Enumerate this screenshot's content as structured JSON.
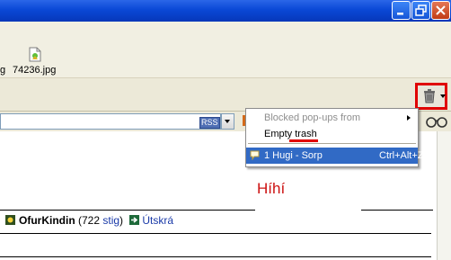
{
  "window": {
    "controls": [
      "minimize",
      "restore",
      "close"
    ]
  },
  "file_strip": {
    "items": [
      {
        "label": "g",
        "icon": "file-icon"
      },
      {
        "label": "74236.jpg",
        "icon": "image-file-icon"
      }
    ]
  },
  "toolbar": {
    "trash_button_icon": "trash-can-icon"
  },
  "address_bar": {
    "feed_badge": "RSS"
  },
  "popup_menu": {
    "items": [
      {
        "label": "Blocked pop-ups from",
        "state": "disabled",
        "submenu": true
      },
      {
        "label": "Empty trash",
        "state": "enabled"
      },
      {
        "label": "1 Hugi - Sorp",
        "shortcut": "Ctrl+Alt+Z",
        "state": "highlighted",
        "icon": "message-icon"
      }
    ]
  },
  "page": {
    "heading": "Híhí",
    "user": {
      "name": "OfurKindin",
      "points_open": "(722 ",
      "points_label": "stig",
      "points_close": ")",
      "logout_label": "Útskrá"
    }
  },
  "colors": {
    "title_bar": "#0a48d6",
    "highlight": "#316ac5",
    "annotation_red": "#e00000",
    "heading_red": "#cc1111",
    "link_blue": "#1a3aa8"
  }
}
